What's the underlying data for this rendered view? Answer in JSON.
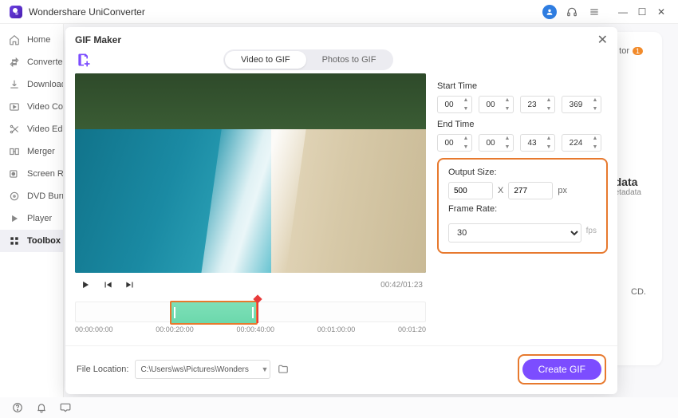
{
  "app": {
    "title": "Wondershare UniConverter"
  },
  "sidebar": {
    "items": [
      {
        "label": "Home",
        "icon": "home"
      },
      {
        "label": "Converter",
        "icon": "convert"
      },
      {
        "label": "Downloader",
        "icon": "download"
      },
      {
        "label": "Video Compressor",
        "icon": "compress"
      },
      {
        "label": "Video Editor",
        "icon": "scissors"
      },
      {
        "label": "Merger",
        "icon": "merge"
      },
      {
        "label": "Screen Recorder",
        "icon": "record"
      },
      {
        "label": "DVD Burner",
        "icon": "dvd"
      },
      {
        "label": "Player",
        "icon": "play"
      },
      {
        "label": "Toolbox",
        "icon": "grid"
      }
    ]
  },
  "background": {
    "section_hint": "tor",
    "badge": "1",
    "panel_title": "data",
    "panel_sub": "etadata",
    "cd_hint": "CD."
  },
  "modal": {
    "title": "GIF Maker",
    "tabs": {
      "video": "Video to GIF",
      "photos": "Photos to GIF"
    },
    "time_current": "00:42",
    "time_total": "01:23",
    "start_label": "Start Time",
    "end_label": "End Time",
    "start": {
      "h": "00",
      "m": "00",
      "s": "23",
      "ms": "369"
    },
    "end": {
      "h": "00",
      "m": "00",
      "s": "43",
      "ms": "224"
    },
    "output_size_label": "Output Size:",
    "width": "500",
    "x": "X",
    "height": "277",
    "px": "px",
    "frame_rate_label": "Frame Rate:",
    "frame_rate": "30",
    "fps": "fps",
    "ticks": [
      "00:00:00:00",
      "00:00:20:00",
      "00:00:40:00",
      "00:01:00:00",
      "00:01:20"
    ],
    "file_location_label": "File Location:",
    "file_location": "C:\\Users\\ws\\Pictures\\Wonders",
    "create_label": "Create GIF",
    "selection": {
      "left_pct": 27,
      "width_pct": 25,
      "playhead_pct": 52
    }
  }
}
